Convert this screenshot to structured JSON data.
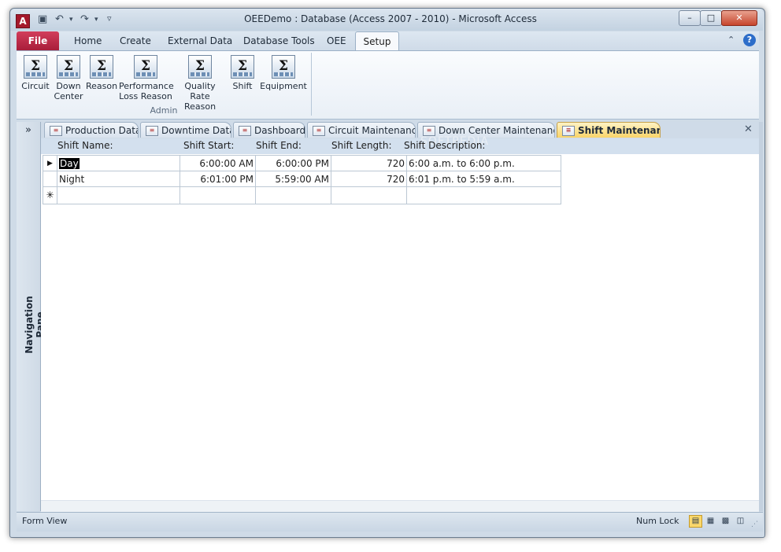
{
  "window": {
    "title": "OEEDemo : Database (Access 2007 - 2010)  -  Microsoft Access",
    "app_icon_letter": "A",
    "controls": {
      "minimize": "–",
      "maximize": "□",
      "close": "✕"
    }
  },
  "ribbon": {
    "tabs": {
      "file": "File",
      "home": "Home",
      "create": "Create",
      "external_data": "External Data",
      "database_tools": "Database Tools",
      "oee": "OEE",
      "setup": "Setup"
    },
    "buttons": {
      "circuit": "Circuit",
      "down_center_1": "Down",
      "down_center_2": "Center",
      "reason": "Reason",
      "perf_1": "Performance",
      "perf_2": "Loss Reason",
      "quality_1": "Quality Rate",
      "quality_2": "Reason",
      "shift": "Shift",
      "equipment": "Equipment"
    },
    "sigma": "Σ",
    "group_label": "Admin"
  },
  "nav": {
    "toggle": "»",
    "label": "Navigation Pane"
  },
  "doc_tabs": {
    "production_data": "Production Data",
    "downtime_data": "Downtime Data",
    "dashboard": "Dashboard",
    "circuit_maintenance": "Circuit Maintenance",
    "down_center_maintenance": "Down Center Maintenance",
    "shift_maintenance": "Shift Maintenance",
    "close": "✕"
  },
  "form": {
    "headers": {
      "name": "Shift Name:",
      "start": "Shift Start:",
      "end": "Shift End:",
      "length": "Shift Length:",
      "description": "Shift Description:"
    },
    "rows": [
      {
        "selector": "▶",
        "name": "Day",
        "start": "6:00:00 AM",
        "end": "6:00:00 PM",
        "length": "720",
        "description": "6:00 a.m. to 6:00 p.m."
      },
      {
        "selector": "",
        "name": "Night",
        "start": "6:01:00 PM",
        "end": "5:59:00 AM",
        "length": "720",
        "description": "6:01 p.m. to 5:59 a.m."
      }
    ],
    "new_row_selector": "✳"
  },
  "status": {
    "left": "Form View",
    "numlock": "Num Lock"
  }
}
